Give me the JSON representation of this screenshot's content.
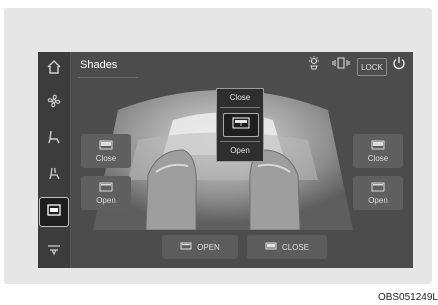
{
  "screen": {
    "title": "Shades",
    "lock_label": "LOCK",
    "sidebar": [
      {
        "icon": "home-icon",
        "active": false
      },
      {
        "icon": "fan-icon",
        "active": false
      },
      {
        "icon": "seat-icon",
        "active": false
      },
      {
        "icon": "seat-heat-icon",
        "active": false
      },
      {
        "icon": "shade-icon",
        "active": true
      },
      {
        "icon": "more-icon",
        "active": false
      }
    ],
    "top_icons": [
      "light-icon",
      "door-mirror-icon",
      "power-icon"
    ]
  },
  "sunroof_popup": {
    "close_label": "Close",
    "open_label": "Open"
  },
  "left_controls": {
    "close_label": "Close",
    "open_label": "Open"
  },
  "right_controls": {
    "close_label": "Close",
    "open_label": "Open"
  },
  "bottom_buttons": {
    "open_all_label": "OPEN",
    "close_all_label": "CLOSE"
  },
  "caption": "OBS051249L"
}
